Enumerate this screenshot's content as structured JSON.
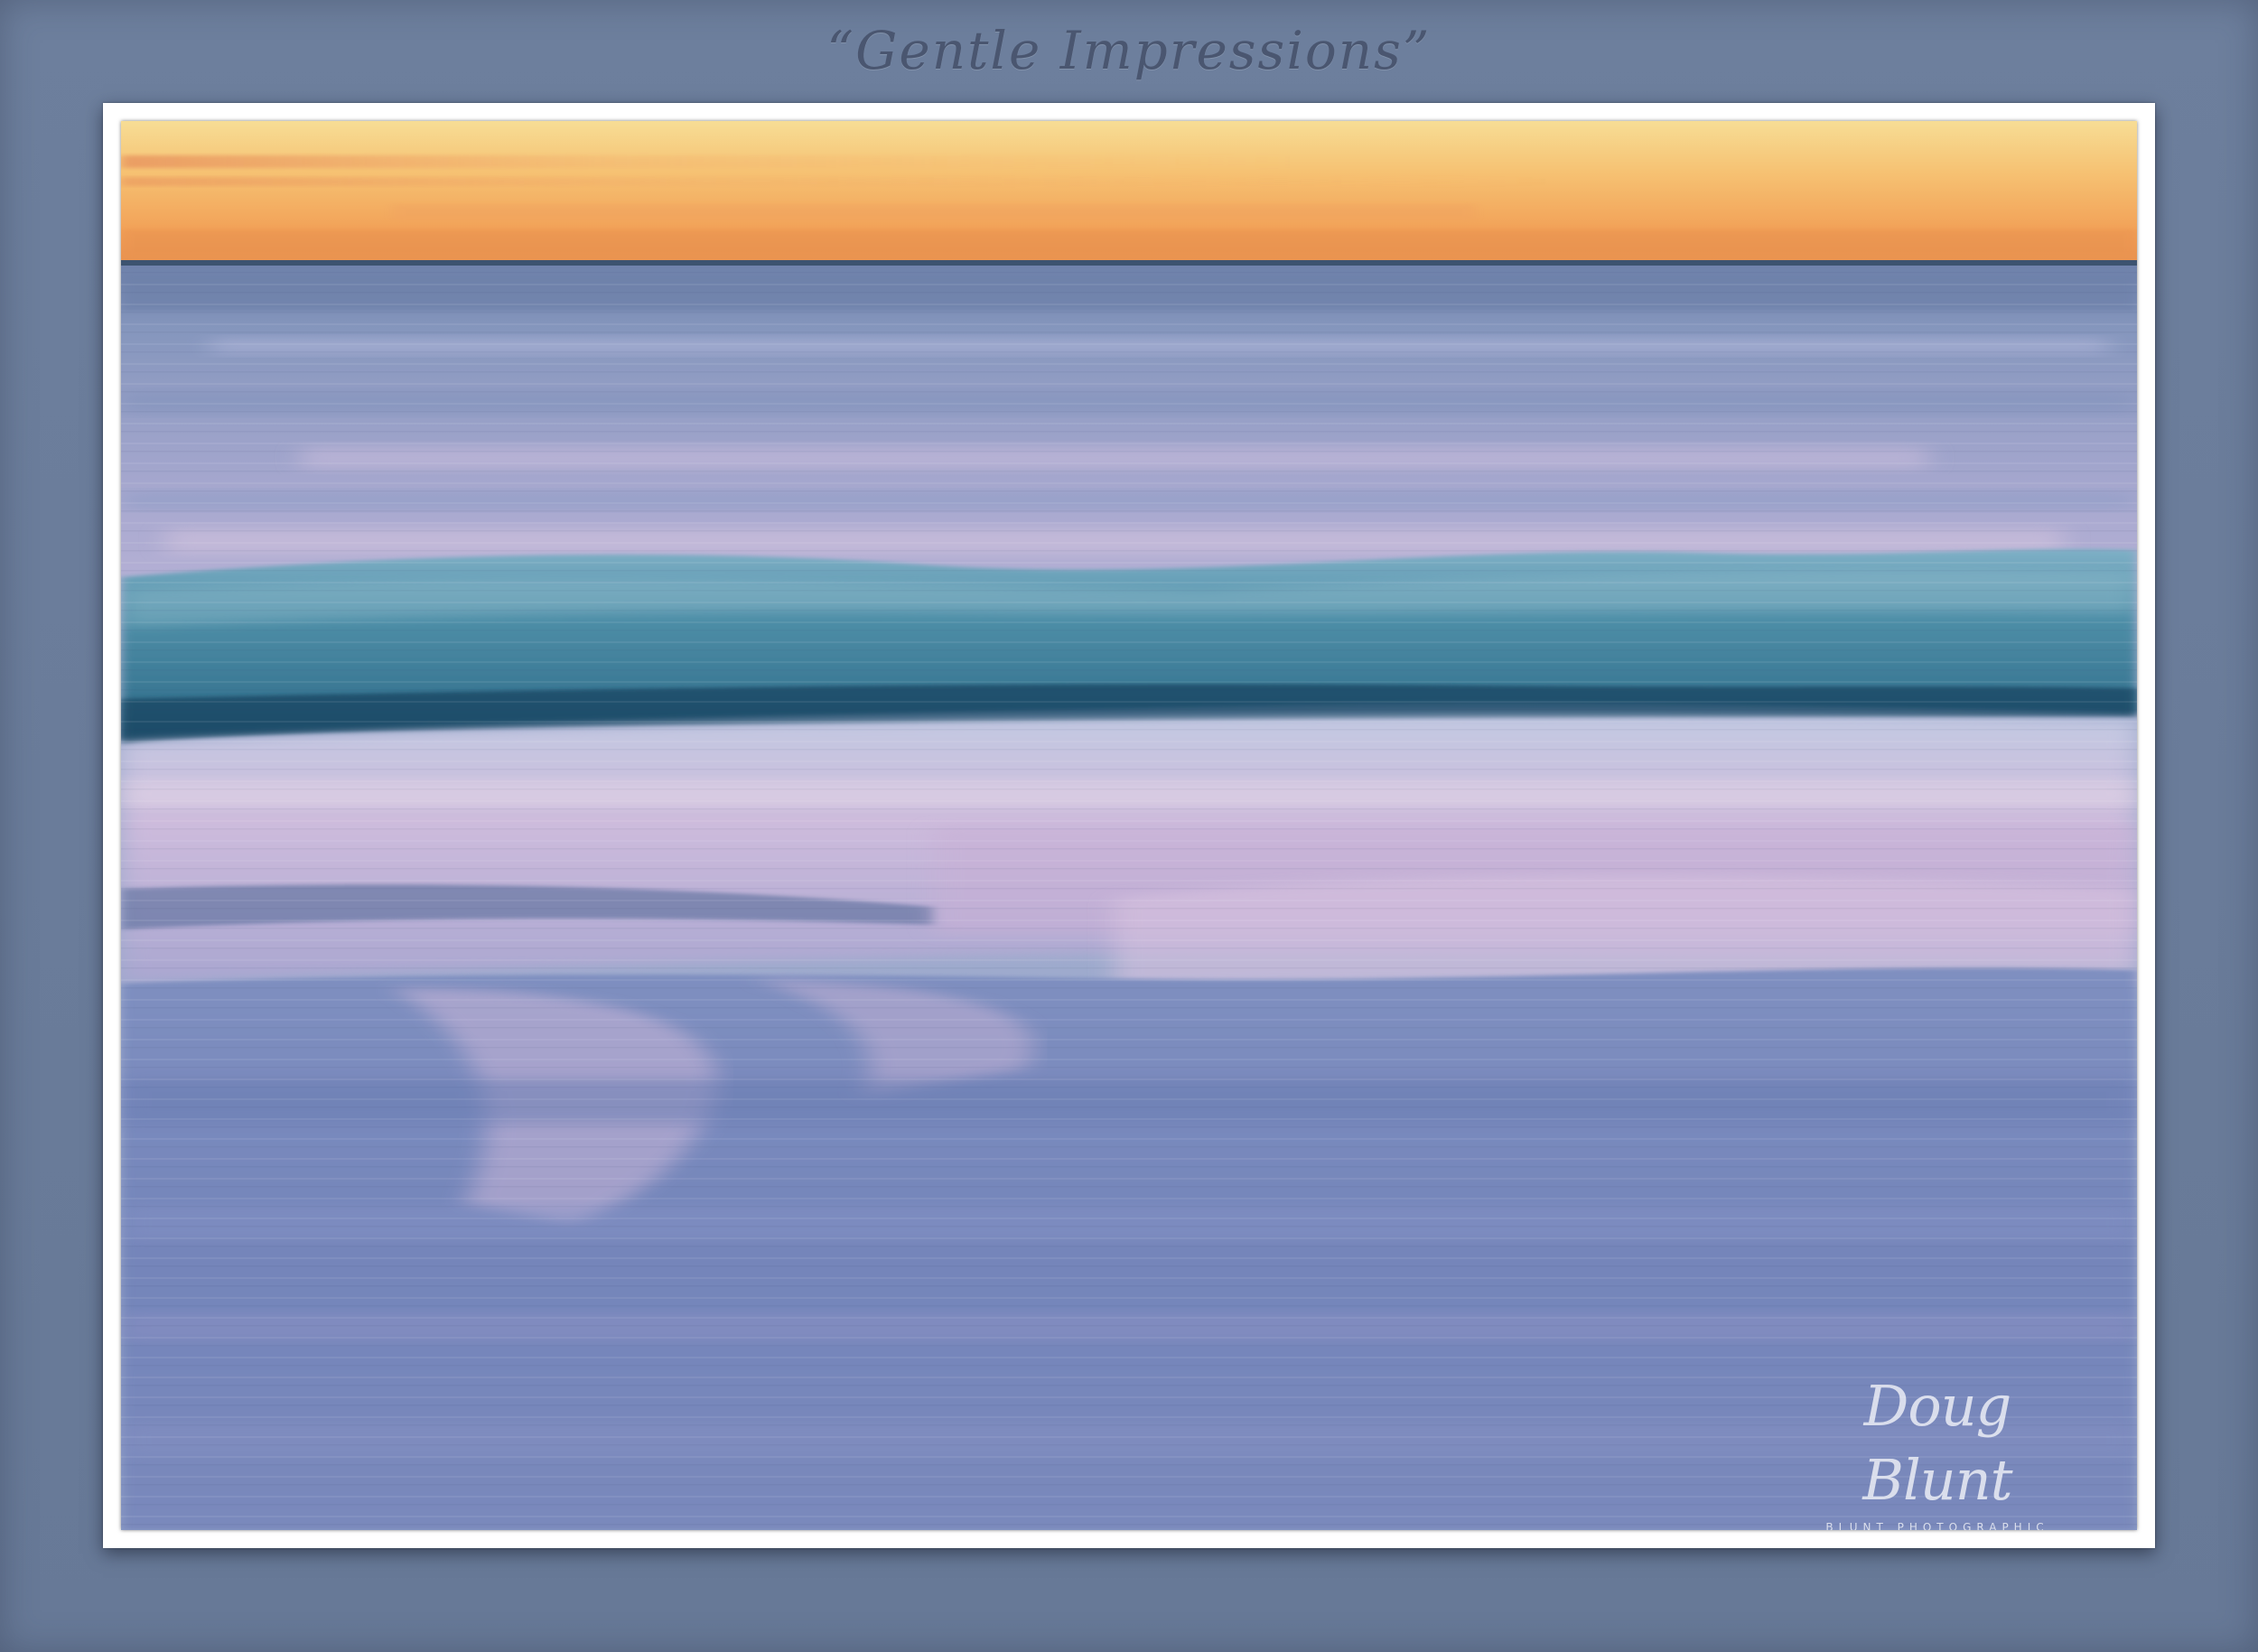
{
  "title": "“Gentle Impressions”",
  "photo": {
    "subject": "seascape-long-exposure-photo",
    "colors": {
      "sky_top": "#f6d98c",
      "sky_mid": "#f5b466",
      "sky_low": "#ef9a52",
      "horizon": "#3d5370",
      "water_far": "#8e9fc4",
      "wave_teal": "#3f7f99",
      "wave_dark": "#1f4f6c",
      "foam_pink": "#c9b3d6",
      "sand_blue": "#7688bc"
    }
  },
  "watermark": {
    "signature": "Doug Blunt",
    "studio": "BLUNT PHOTOGRAPHIC"
  },
  "mat_color": "#6b7d9b"
}
